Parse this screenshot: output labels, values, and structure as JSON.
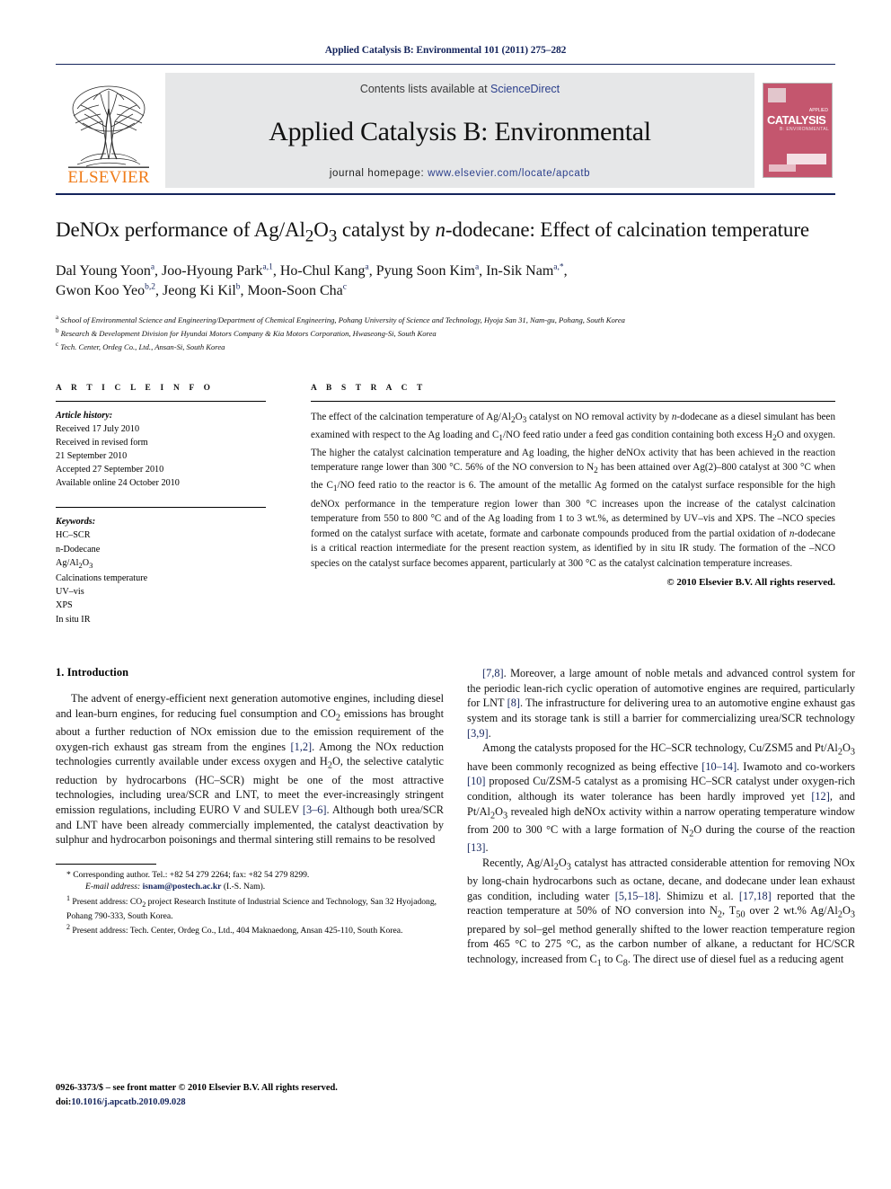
{
  "running_head": "Applied Catalysis B: Environmental 101 (2011) 275–282",
  "banner": {
    "publisher_name": "ELSEVIER",
    "contents_prefix": "Contents lists available at ",
    "contents_link": "ScienceDirect",
    "journal_title": "Applied Catalysis B: Environmental",
    "homepage_label": "journal homepage: ",
    "homepage_url": "www.elsevier.com/locate/apcatb",
    "cover": {
      "word": "CATALYSIS",
      "subtitle": "B: ENVIRONMENTAL",
      "tag": "APPLIED"
    },
    "accent_link_color": "#2b3f8c",
    "elsevier_orange": "#f07c19",
    "cover_color": "#c4566e",
    "banner_bg": "#e6e7e8"
  },
  "article": {
    "title": "DeNOx performance of Ag/Al2O3 catalyst by n-dodecane: Effect of calcination temperature",
    "authors_line_1": "Dal Young Yoon a, Joo-Hyoung Park a,1, Ho-Chul Kang a, Pyung Soon Kim a, In-Sik Nam a,*,",
    "authors_line_2": "Gwon Koo Yeo b,2, Jeong Ki Kil b, Moon-Soon Cha c",
    "affiliations": [
      "a School of Environmental Science and Engineering/Department of Chemical Engineering, Pohang University of Science and Technology, Hyoja San 31, Nam-gu, Pohang, South Korea",
      "b Research & Development Division for Hyundai Motors Company & Kia Motors Corporation, Hwaseong-Si, South Korea",
      "c Tech. Center, Ordeg Co., Ltd., Ansan-Si, South Korea"
    ]
  },
  "article_info": {
    "heading": "A R T I C L E   I N F O",
    "history_label": "Article history:",
    "history": [
      "Received 17 July 2010",
      "Received in revised form",
      "21 September 2010",
      "Accepted 27 September 2010",
      "Available online 24 October 2010"
    ],
    "keywords_label": "Keywords:",
    "keywords": [
      "HC–SCR",
      "n-Dodecane",
      "Ag/Al2O3",
      "Calcinations temperature",
      "UV–vis",
      "XPS",
      "In situ IR"
    ]
  },
  "abstract": {
    "heading": "A B S T R A C T",
    "copyright": "© 2010 Elsevier B.V. All rights reserved."
  },
  "introduction": {
    "heading": "1.  Introduction"
  },
  "footnotes": {
    "corresponding_mark": "*",
    "corresponding_text": "Corresponding author. Tel.: +82 54 279 2264; fax: +82 54 279 8299.",
    "email_label": "E-mail address:",
    "email": "isnam@postech.ac.kr",
    "email_suffix": "(I.-S. Nam).",
    "note1_mark": "1",
    "note1": "Present address: CO2 project Research Institute of Industrial Science and Technology, San 32 Hyojadong, Pohang 790-333, South Korea.",
    "note2_mark": "2",
    "note2": "Present address: Tech. Center, Ordeg Co., Ltd., 404 Maknaedong, Ansan 425-110, South Korea."
  },
  "bottom_matter": {
    "issn_line": "0926-3373/$ – see front matter © 2010 Elsevier B.V. All rights reserved.",
    "doi_label": "doi:",
    "doi": "10.1016/j.apcatb.2010.09.028"
  }
}
